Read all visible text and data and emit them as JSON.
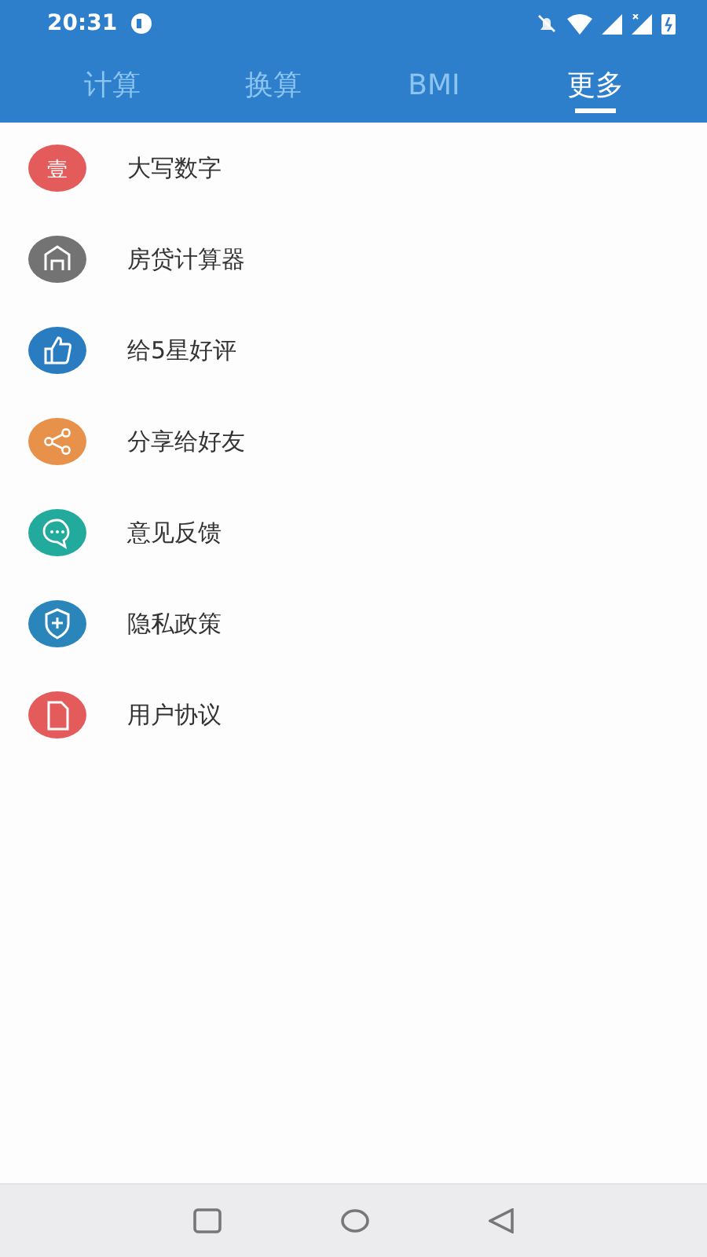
{
  "status_bar": {
    "time": "20:31"
  },
  "tabs": [
    {
      "label": "计算",
      "selected": false
    },
    {
      "label": "换算",
      "selected": false
    },
    {
      "label": "BMI",
      "selected": false
    },
    {
      "label": "更多",
      "selected": true
    }
  ],
  "menu": [
    {
      "label": "大写数字",
      "kind": "glyph",
      "icon_text": "壹",
      "color": "#e35b5b"
    },
    {
      "label": "房贷计算器",
      "kind": "house",
      "color": "#737373"
    },
    {
      "label": "给5星好评",
      "kind": "thumb",
      "color": "#2a7cc0"
    },
    {
      "label": "分享给好友",
      "kind": "share",
      "color": "#e8914a"
    },
    {
      "label": "意见反馈",
      "kind": "chat",
      "color": "#22aa9c"
    },
    {
      "label": "隐私政策",
      "kind": "shield",
      "color": "#2a85bb"
    },
    {
      "label": "用户协议",
      "kind": "document",
      "color": "#e35b5b"
    }
  ]
}
